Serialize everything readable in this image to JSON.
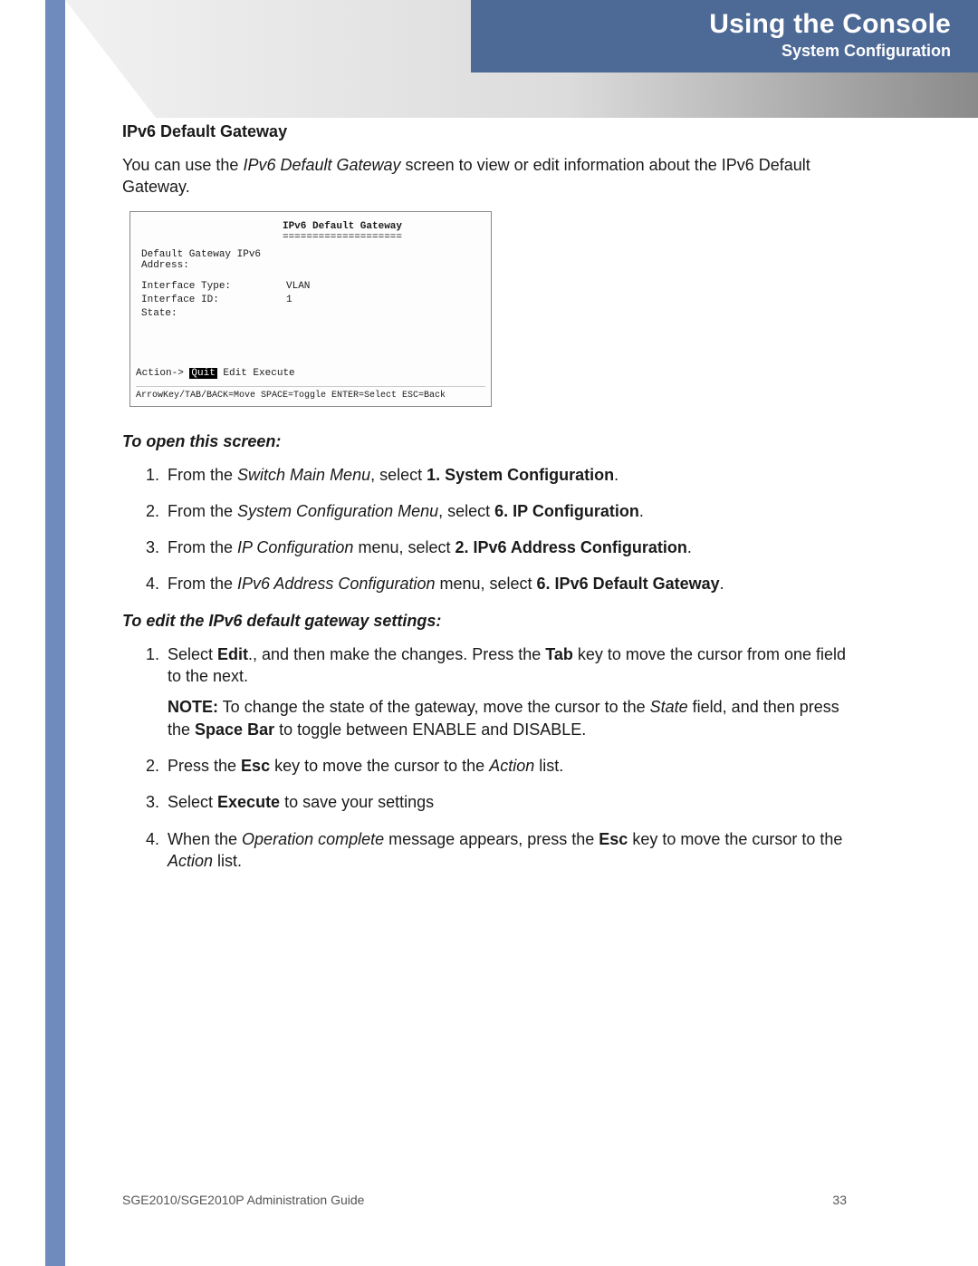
{
  "header": {
    "title": "Using the Console",
    "subtitle": "System Configuration"
  },
  "section": {
    "heading": "IPv6 Default Gateway",
    "intro_a": "You can use the ",
    "intro_i": "IPv6 Default Gateway",
    "intro_b": " screen to view or edit information about the IPv6 Default Gateway."
  },
  "console": {
    "title": "IPv6 Default Gateway",
    "underline": "====================",
    "rows": [
      {
        "label": "Default Gateway IPv6 Address:",
        "value": ""
      },
      {
        "label": "Interface Type:",
        "value": "VLAN"
      },
      {
        "label": "Interface ID:",
        "value": "1"
      },
      {
        "label": "State:",
        "value": ""
      }
    ],
    "action_prefix": "Action->",
    "action_sel": "Quit",
    "action_rest": "  Edit   Execute",
    "hint": "ArrowKey/TAB/BACK=Move  SPACE=Toggle  ENTER=Select  ESC=Back"
  },
  "open": {
    "heading": "To open this screen:",
    "s1a": "From the ",
    "s1i": "Switch Main Menu",
    "s1b": ", select ",
    "s1bold": "1. System Configuration",
    "s1end": ".",
    "s2a": "From the ",
    "s2i": "System Configuration Menu",
    "s2b": ", select ",
    "s2bold": "6. IP Configuration",
    "s2end": ".",
    "s3a": "From the ",
    "s3i": "IP Configuration",
    "s3b": " menu, select ",
    "s3bold": "2. IPv6 Address Configuration",
    "s3end": ".",
    "s4a": "From the ",
    "s4i": "IPv6 Address Configuration",
    "s4b": " menu, select ",
    "s4bold": "6. IPv6 Default Gateway",
    "s4end": "."
  },
  "edit": {
    "heading": "To edit the IPv6 default gateway settings:",
    "s1a": "Select ",
    "s1b": "Edit",
    "s1c": "., and then make the changes. Press the ",
    "s1d": "Tab",
    "s1e": " key to move the cursor from one field to the next.",
    "note_label": "NOTE:",
    "note_a": " To change the state of the gateway, move the cursor to the ",
    "note_i": "State",
    "note_b": " field, and then press the ",
    "note_bold": "Space Bar",
    "note_c": " to toggle between ENABLE and DISABLE.",
    "s2a": "Press the ",
    "s2b": "Esc",
    "s2c": " key to move the cursor to the ",
    "s2i": "Action",
    "s2d": " list.",
    "s3a": "Select ",
    "s3b": "Execute",
    "s3c": " to save your settings",
    "s4a": "When the ",
    "s4i": "Operation complete",
    "s4b": " message appears, press the ",
    "s4bold": "Esc",
    "s4c": " key to move the cursor to the ",
    "s4i2": "Action",
    "s4d": " list."
  },
  "footer": {
    "left": "SGE2010/SGE2010P Administration Guide",
    "right": "33"
  }
}
